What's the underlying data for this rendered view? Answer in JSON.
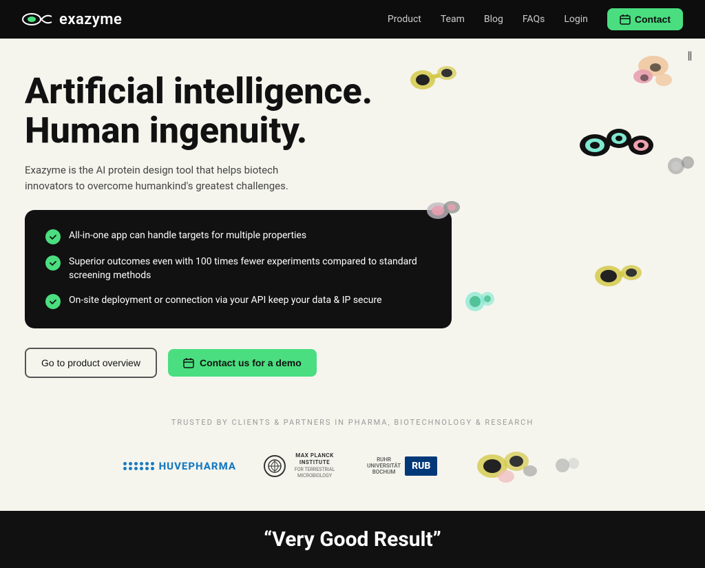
{
  "nav": {
    "logo_text": "exazyme",
    "links": [
      "Product",
      "Team",
      "Blog",
      "FAQs",
      "Login"
    ],
    "contact_btn": "Contact"
  },
  "hero": {
    "headline_line1": "Artificial intelligence.",
    "headline_line2": "Human ingenuity.",
    "subtitle": "Exazyme is the AI protein design tool that helps biotech innovators to overcome humankind's greatest challenges.",
    "features": [
      "All-in-one app can handle targets for multiple properties",
      "Superior outcomes even with 100 times fewer experiments compared to standard screening methods",
      "On-site deployment or connection via your API keep your data & IP secure"
    ],
    "btn_overview": "Go to product overview",
    "btn_demo_icon": "calendar-icon",
    "btn_demo": "Contact us for a demo"
  },
  "trusted": {
    "label": "TRUSTED BY CLIENTS & PARTNERS IN PHARMA, BIOTECHNOLOGY & RESEARCH",
    "partners": [
      "HUVEPHARMA",
      "MAX PLANCK INSTITUTE FOR TERRESTRIAL MICROBIOLOGY",
      "RUHR UNIVERSITÄT BOCHUM RUB"
    ]
  },
  "testimonial": {
    "quote": "“Very Good Result”"
  },
  "pause_btn": "‖"
}
